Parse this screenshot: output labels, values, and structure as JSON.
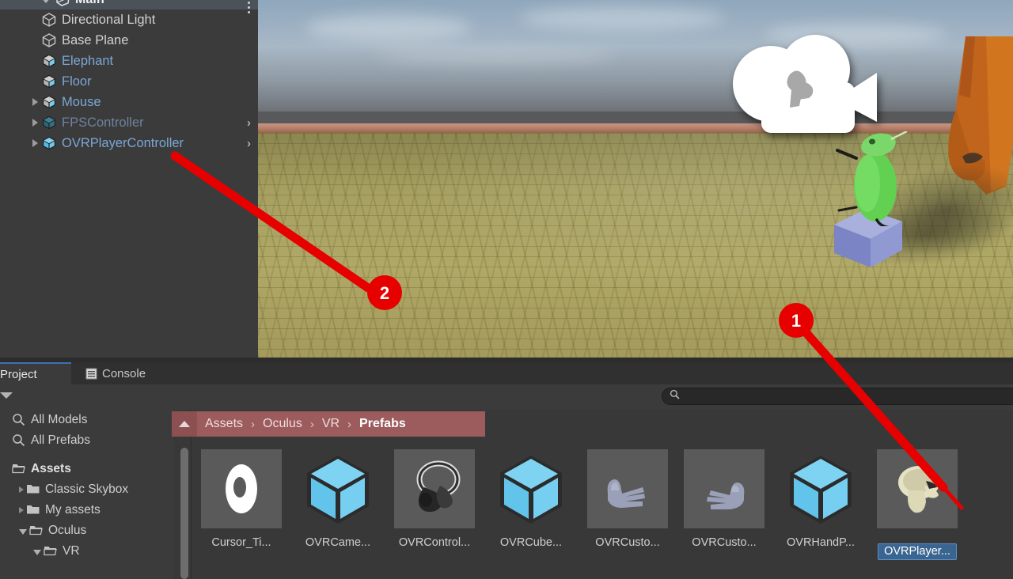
{
  "hierarchy": {
    "scene_name": "Main",
    "kebab_icon": "kebab-menu-icon",
    "items": [
      {
        "label": "Directional Light",
        "icon": "gameobject-icon",
        "kind": "gameobject",
        "foldout": false,
        "chevron": false
      },
      {
        "label": "Base Plane",
        "icon": "gameobject-icon",
        "kind": "gameobject",
        "foldout": false,
        "chevron": false
      },
      {
        "label": "Elephant",
        "icon": "prefab-model-icon",
        "kind": "prefab",
        "foldout": false,
        "chevron": false
      },
      {
        "label": "Floor",
        "icon": "prefab-model-icon",
        "kind": "prefab",
        "foldout": false,
        "chevron": false
      },
      {
        "label": "Mouse",
        "icon": "prefab-model-icon",
        "kind": "prefab",
        "foldout": true,
        "chevron": false
      },
      {
        "label": "FPSController",
        "icon": "prefab-icon",
        "kind": "prefab-dim",
        "foldout": true,
        "chevron": true
      },
      {
        "label": "OVRPlayerController",
        "icon": "prefab-icon",
        "kind": "prefab",
        "foldout": true,
        "chevron": true
      }
    ]
  },
  "scene_view": {
    "camera_gizmo_icon": "camera-gizmo-icon",
    "objects": [
      "green-character",
      "orange-character",
      "blue-cube",
      "brick-plaza",
      "sky"
    ]
  },
  "project_panel": {
    "tabs": [
      {
        "label": "Project",
        "icon": "",
        "active": true
      },
      {
        "label": "Console",
        "icon": "console-icon",
        "active": false
      }
    ],
    "search": {
      "value": "",
      "placeholder": "",
      "icon": "search-icon"
    },
    "favorites": [
      {
        "label": "All Models",
        "icon": "search-icon"
      },
      {
        "label": "All Prefabs",
        "icon": "search-icon"
      }
    ],
    "tree": [
      {
        "label": "Assets",
        "icon": "folder-open-icon",
        "indent": 0,
        "state": "open",
        "bold": true
      },
      {
        "label": "Classic Skybox",
        "icon": "folder-icon",
        "indent": 1,
        "state": "closed",
        "bold": false
      },
      {
        "label": "My assets",
        "icon": "folder-icon",
        "indent": 1,
        "state": "closed",
        "bold": false
      },
      {
        "label": "Oculus",
        "icon": "folder-open-icon",
        "indent": 1,
        "state": "open",
        "bold": false
      },
      {
        "label": "VR",
        "icon": "folder-open-icon",
        "indent": 2,
        "state": "open",
        "bold": false
      }
    ],
    "breadcrumb": {
      "up_icon": "up-arrow-icon",
      "parts": [
        "Assets",
        "Oculus",
        "VR",
        "Prefabs"
      ],
      "separator": "›"
    },
    "assets": [
      {
        "name": "Cursor_Ti...",
        "icon": "torus-mesh-icon",
        "selected": false
      },
      {
        "name": "OVRCame...",
        "icon": "prefab-cube-icon",
        "selected": false
      },
      {
        "name": "OVRControl...",
        "icon": "vr-controller-mesh-icon",
        "selected": false
      },
      {
        "name": "OVRCube...",
        "icon": "prefab-cube-icon",
        "selected": false
      },
      {
        "name": "OVRCusto...",
        "icon": "left-hand-mesh-icon",
        "selected": false
      },
      {
        "name": "OVRCusto...",
        "icon": "right-hand-mesh-icon",
        "selected": false
      },
      {
        "name": "OVRHandP...",
        "icon": "prefab-cube-icon",
        "selected": false
      },
      {
        "name": "OVRPlayer...",
        "icon": "player-controller-mesh-icon",
        "selected": true
      }
    ]
  },
  "annotations": [
    {
      "number": "1",
      "color": "#e60000"
    },
    {
      "number": "2",
      "color": "#e60000"
    }
  ],
  "colors": {
    "panel_bg": "#3b3b3b",
    "header_bg": "#4b5259",
    "prefab_blue": "#7ba7d7",
    "breadcrumb_bg": "#9c5b5d",
    "selection_blue": "#3b6591",
    "tab_accent": "#3f6fb5",
    "annotation_red": "#e60000"
  }
}
